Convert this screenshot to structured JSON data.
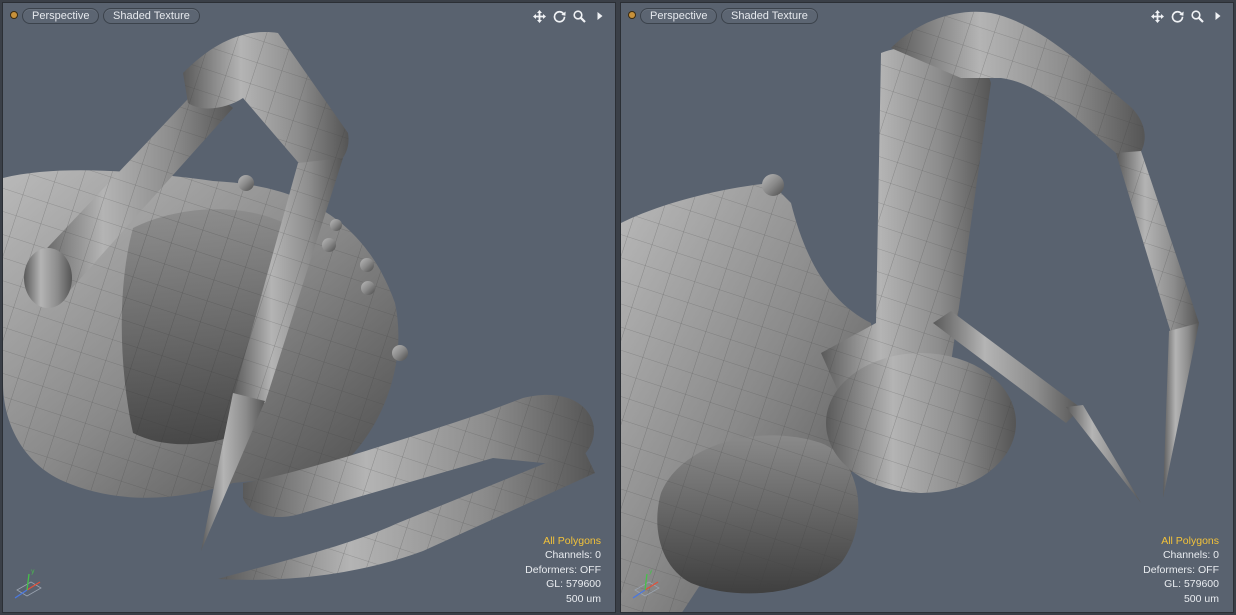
{
  "viewports": [
    {
      "id": "left",
      "view_label": "Perspective",
      "shading_label": "Shaded Texture",
      "hud": {
        "selection": "All Polygons",
        "channels": "Channels: 0",
        "deformers": "Deformers: OFF",
        "gl": "GL: 579600",
        "units": "500 um"
      }
    },
    {
      "id": "right",
      "view_label": "Perspective",
      "shading_label": "Shaded Texture",
      "hud": {
        "selection": "All Polygons",
        "channels": "Channels: 0",
        "deformers": "Deformers: OFF",
        "gl": "GL: 579600",
        "units": "500 um"
      }
    }
  ],
  "icons": [
    "move-view-icon",
    "rotate-view-icon",
    "zoom-view-icon",
    "viewport-menu-arrow-icon",
    "axis-gizmo-icon"
  ],
  "colors": {
    "viewport_bg": "#59626f",
    "model_gray": "#8e8e8e",
    "hud_highlight": "#f2c23a",
    "hud_text": "#e9ecf0"
  }
}
